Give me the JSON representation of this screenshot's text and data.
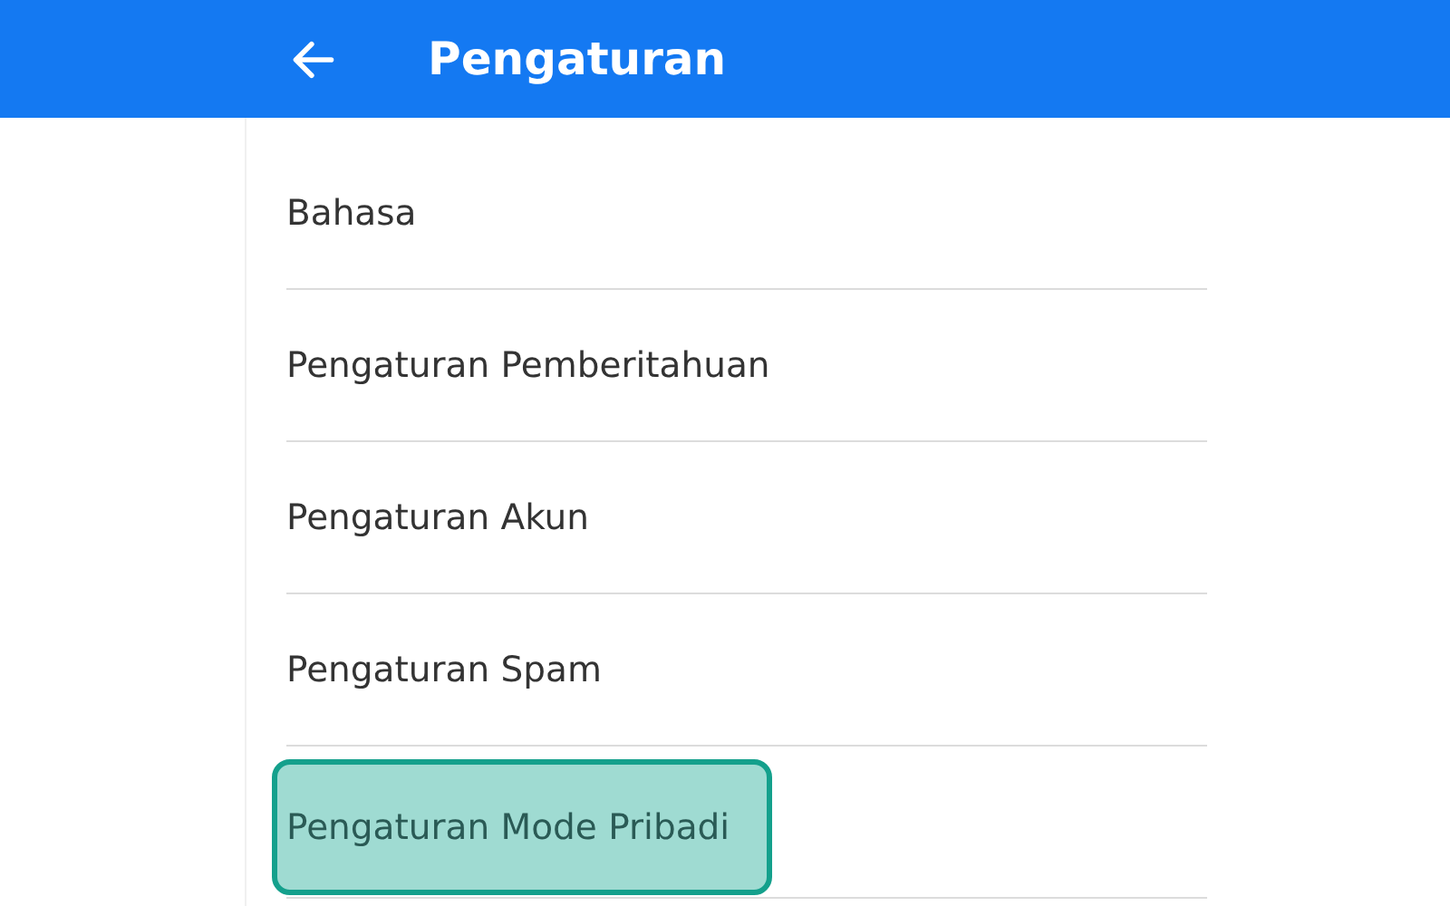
{
  "header": {
    "title": "Pengaturan"
  },
  "items": [
    {
      "label": "Bahasa",
      "highlighted": false
    },
    {
      "label": "Pengaturan Pemberitahuan",
      "highlighted": false
    },
    {
      "label": "Pengaturan Akun",
      "highlighted": false
    },
    {
      "label": "Pengaturan Spam",
      "highlighted": false
    },
    {
      "label": "Pengaturan Mode Pribadi",
      "highlighted": true
    }
  ]
}
